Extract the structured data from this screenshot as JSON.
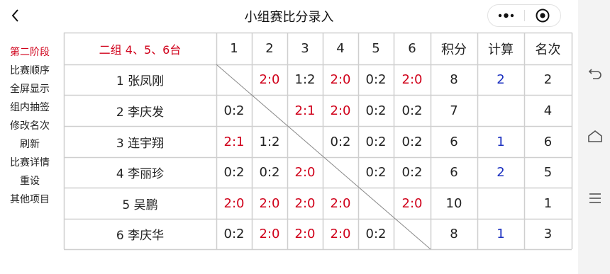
{
  "header": {
    "title": "小组赛比分录入"
  },
  "sidebar": {
    "items": [
      {
        "label": "第二阶段",
        "active": true
      },
      {
        "label": "比赛顺序"
      },
      {
        "label": "全屏显示"
      },
      {
        "label": "组内抽签"
      },
      {
        "label": "修改名次"
      },
      {
        "label": "刷新"
      },
      {
        "label": "比赛详情"
      },
      {
        "label": "重设"
      },
      {
        "label": "其他项目"
      }
    ]
  },
  "table": {
    "group_label": "二组 4、5、6台",
    "columns": [
      "1",
      "2",
      "3",
      "4",
      "5",
      "6",
      "积分",
      "计算",
      "名次"
    ],
    "rows": [
      {
        "player": "1 张凤刚",
        "scores": [
          null,
          "2:0",
          "1:2",
          "2:0",
          "0:2",
          "2:0"
        ],
        "points": "8",
        "calc": "2",
        "rank": "2"
      },
      {
        "player": "2 李庆发",
        "scores": [
          "0:2",
          null,
          "2:1",
          "2:0",
          "0:2",
          "0:2"
        ],
        "points": "7",
        "calc": "",
        "rank": "4"
      },
      {
        "player": "3 连宇翔",
        "scores": [
          "2:1",
          "1:2",
          null,
          "0:2",
          "0:2",
          "0:2"
        ],
        "points": "6",
        "calc": "1",
        "rank": "6"
      },
      {
        "player": "4 李丽珍",
        "scores": [
          "0:2",
          "0:2",
          "2:0",
          null,
          "0:2",
          "0:2"
        ],
        "points": "6",
        "calc": "2",
        "rank": "5"
      },
      {
        "player": "5 吴鹏",
        "scores": [
          "2:0",
          "2:0",
          "2:0",
          "2:0",
          null,
          "2:0"
        ],
        "points": "10",
        "calc": "",
        "rank": "1"
      },
      {
        "player": "6 李庆华",
        "scores": [
          "0:2",
          "2:0",
          "2:0",
          "2:0",
          "0:2",
          null
        ],
        "points": "8",
        "calc": "1",
        "rank": "3"
      }
    ]
  },
  "colors": {
    "win": "#d0021b",
    "calc": "#1a2fbf",
    "grid_line": "#cfcfcf",
    "diagonal": "#8a8a8a"
  },
  "icons": {
    "back": "chevron-left-icon",
    "more": "more-dots-icon",
    "close": "target-close-icon",
    "nav_back": "nav-back-icon",
    "nav_home": "nav-home-icon",
    "nav_menu": "nav-menu-icon"
  }
}
